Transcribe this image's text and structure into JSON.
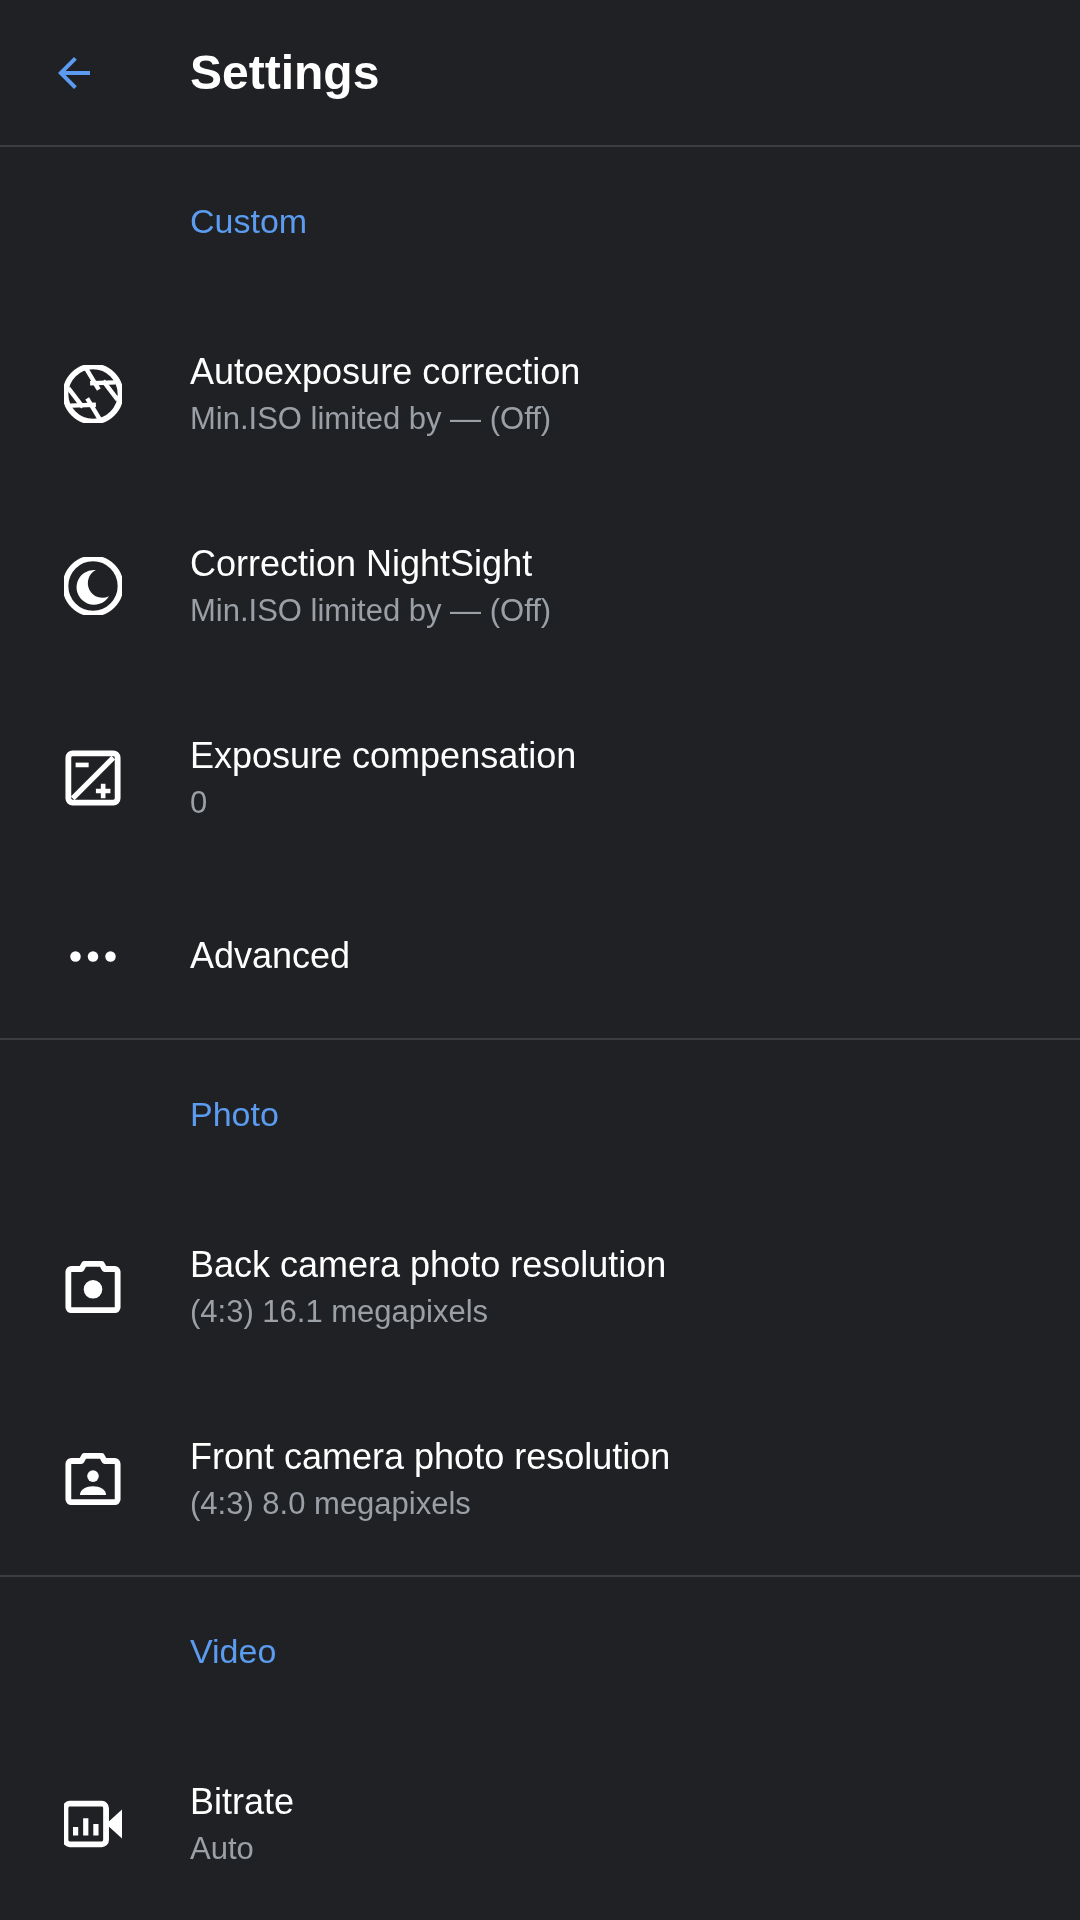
{
  "header": {
    "title": "Settings"
  },
  "sections": [
    {
      "title": "Custom",
      "items": [
        {
          "kind": "aperture",
          "title": "Autoexposure correction",
          "subtitle": "Min.ISO limited by — (Off)"
        },
        {
          "kind": "moon",
          "title": "Correction NightSight",
          "subtitle": "Min.ISO limited by — (Off)"
        },
        {
          "kind": "exposure",
          "title": "Exposure compensation",
          "subtitle": "0"
        },
        {
          "kind": "more",
          "title": "Advanced"
        }
      ]
    },
    {
      "title": "Photo",
      "items": [
        {
          "kind": "camera",
          "title": "Back camera photo resolution",
          "subtitle": "(4:3) 16.1 megapixels"
        },
        {
          "kind": "front-camera",
          "title": "Front camera photo resolution",
          "subtitle": "(4:3) 8.0 megapixels"
        }
      ]
    },
    {
      "title": "Video",
      "items": [
        {
          "kind": "video",
          "title": "Bitrate",
          "subtitle": "Auto"
        }
      ]
    }
  ]
}
